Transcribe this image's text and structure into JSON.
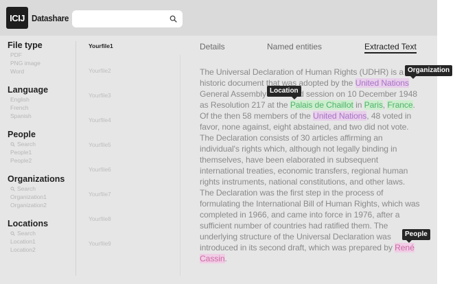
{
  "app": {
    "logo": "ICIJ",
    "name": "Datashare"
  },
  "search": {
    "value": "",
    "placeholder": ""
  },
  "filters": {
    "file_type": {
      "title": "File type",
      "options": [
        "PDF",
        "PNG image",
        "Word"
      ]
    },
    "language": {
      "title": "Language",
      "options": [
        "English",
        "French",
        "Spanish"
      ]
    },
    "people": {
      "title": "People",
      "search": "Search",
      "options": [
        "People1",
        "People2"
      ]
    },
    "organizations": {
      "title": "Organizations",
      "search": "Search",
      "options": [
        "Organization1",
        "Organization2"
      ]
    },
    "locations": {
      "title": "Locations",
      "search": "Search",
      "options": [
        "Location1",
        "Location2"
      ]
    }
  },
  "files": [
    "Yourfile1",
    "Yourfile2",
    "Yourfile3",
    "Yourfile4",
    "Yourfile5",
    "Yourfile6",
    "Yourfile7",
    "Yourfile8",
    "Yourfile9"
  ],
  "tabs": {
    "details": "Details",
    "named_entities": "Named entities",
    "extracted_text": "Extracted Text"
  },
  "tooltips": {
    "organization": "Organization",
    "location": "Location",
    "people": "People"
  },
  "document": {
    "p1": "The Universal Declaration of Human Rights (UDHR) is a historic document that was adopted by the ",
    "org1": "United Nations",
    "p2": " General Assembly at its third session on 10 December 1948 as Resolution 217 at the ",
    "loc1": "Palais de Chaillot",
    "p3": " in ",
    "loc2": "Paris",
    "p4": ", ",
    "loc3": "France",
    "p5": ". Of the then 58 members of the ",
    "org2": "United Nations",
    "p6": ", 48 voted in favor, none against, eight abstained, and two did not vote. The Declaration consists of 30 articles affirming an individual's rights which, although not legally binding in themselves, have been elaborated in subsequent international treaties, economic transfers, regional human rights instruments, national constitutions, and other laws. The Declaration was the first step in the process of formulating the International Bill of Human Rights, which was completed in 1966, and came into force in 1976, after a sufficient number of countries had ratified them. The underlying structure of the Universal Declaration was introduced in its second draft, which was prepared by ",
    "per1": "René Cassin",
    "p7": "."
  },
  "colors": {
    "organization_highlight": "#e8cfeb",
    "location_highlight": "#cdeece",
    "people_highlight": "#f1cde5",
    "tooltip_bg": "#262626"
  }
}
